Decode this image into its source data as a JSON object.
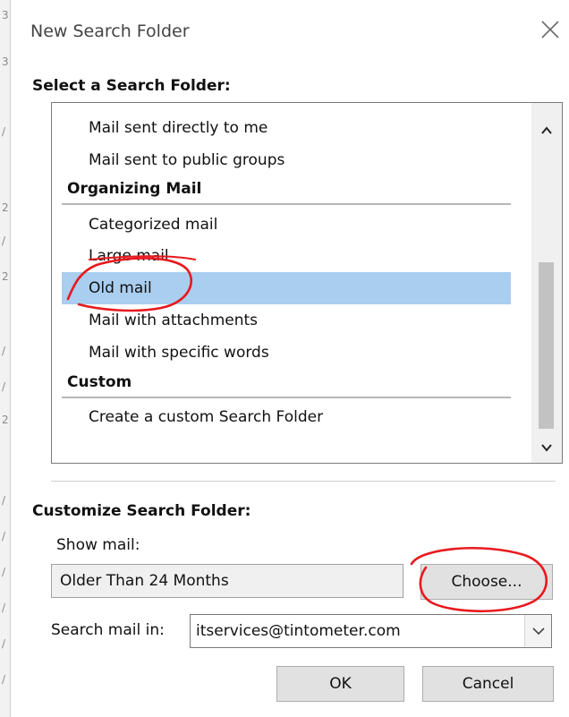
{
  "window": {
    "title": "New Search Folder",
    "close_icon": "close-icon"
  },
  "left_strip_chars": [
    "3",
    "3",
    "/",
    "2",
    "/",
    "2",
    "/",
    "/",
    "2",
    "/",
    "/",
    "/",
    "/",
    "/",
    "/"
  ],
  "select_section": {
    "heading": "Select a Search Folder:",
    "items": [
      {
        "label": "Mail sent directly to me",
        "kind": "item",
        "selected": false
      },
      {
        "label": "Mail sent to public groups",
        "kind": "item",
        "selected": false
      },
      {
        "label": "Organizing Mail",
        "kind": "group",
        "selected": false
      },
      {
        "label": "Categorized mail",
        "kind": "item",
        "selected": false
      },
      {
        "label": "Large mail",
        "kind": "item",
        "selected": false
      },
      {
        "label": "Old mail",
        "kind": "item",
        "selected": true
      },
      {
        "label": "Mail with attachments",
        "kind": "item",
        "selected": false
      },
      {
        "label": "Mail with specific words",
        "kind": "item",
        "selected": false
      },
      {
        "label": "Custom",
        "kind": "group",
        "selected": false
      },
      {
        "label": "Create a custom Search Folder",
        "kind": "item",
        "selected": false
      }
    ],
    "scrollbar": {
      "up_icon": "chevron-up-icon",
      "down_icon": "chevron-down-icon"
    }
  },
  "customize_section": {
    "heading": "Customize Search Folder:",
    "show_mail_label": "Show mail:",
    "show_mail_value": "Older Than 24 Months",
    "choose_button": "Choose...",
    "search_in_label": "Search mail in:",
    "search_in_value": "itservices@tintometer.com",
    "dropdown_icon": "chevron-down-icon"
  },
  "buttons": {
    "ok": "OK",
    "cancel": "Cancel"
  },
  "colors": {
    "selection": "#a9ceef",
    "annotation": "#e8191e"
  }
}
